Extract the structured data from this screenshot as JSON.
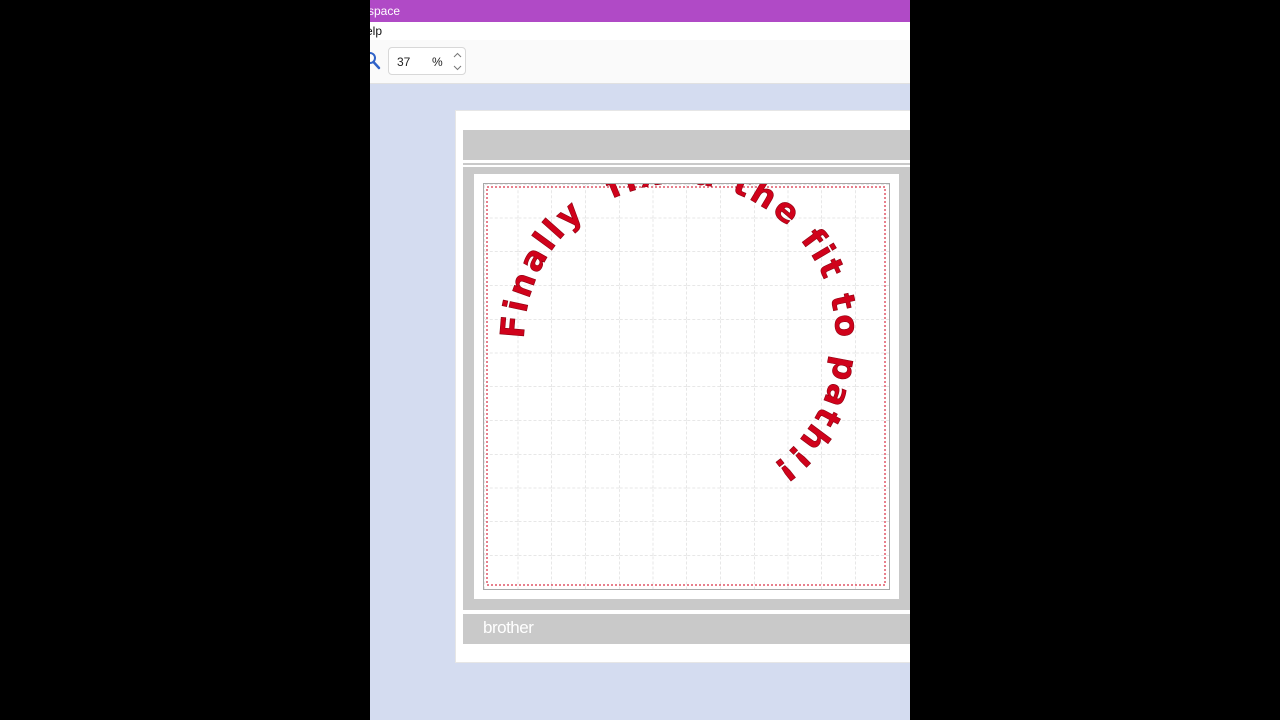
{
  "window": {
    "title_fragment": "space"
  },
  "menu": {
    "help_fragment": "elp"
  },
  "toolbar": {
    "zoom_value": "37",
    "zoom_unit": "%",
    "zoom_icon": "magnifier-icon",
    "spin_up_icon": "chevron-up-icon",
    "spin_down_icon": "chevron-down-icon"
  },
  "mat": {
    "brand": "brother",
    "text_color": "#d0021b",
    "curved_text": "Finally  fixed the fit to path!!!"
  },
  "colors": {
    "title_bar": "#b04ac6",
    "canvas_background": "#d4dcf0",
    "mat_gray": "#c9c9c9"
  }
}
